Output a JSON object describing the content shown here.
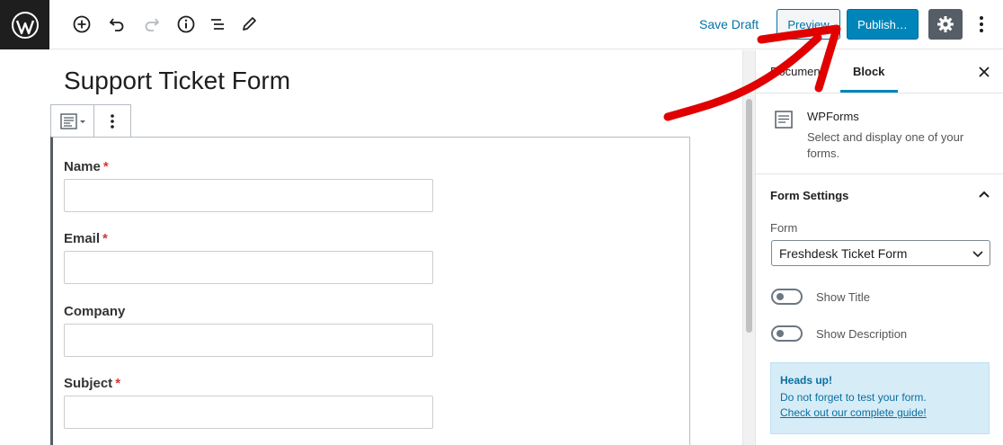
{
  "toolbar": {
    "save_draft_label": "Save Draft",
    "preview_label": "Preview",
    "publish_label": "Publish…",
    "colors": {
      "publish": "#0085ba",
      "settings": "#555d66",
      "link": "#0073aa"
    }
  },
  "editor": {
    "post_title": "Support Ticket Form",
    "fields": [
      {
        "label": "Name",
        "required": "*"
      },
      {
        "label": "Email",
        "required": "*"
      },
      {
        "label": "Company",
        "required": ""
      },
      {
        "label": "Subject",
        "required": "*"
      }
    ]
  },
  "sidebar": {
    "tabs": {
      "document": "Document",
      "block": "Block"
    },
    "block_card": {
      "title": "WPForms",
      "description": "Select and display one of your forms."
    },
    "panel": {
      "title": "Form Settings",
      "form_label": "Form",
      "form_selected": "Freshdesk Ticket Form",
      "toggles": [
        {
          "label": "Show Title",
          "state": "off"
        },
        {
          "label": "Show Description",
          "state": "off"
        }
      ]
    },
    "notice": {
      "title": "Heads up!",
      "text": "Do not forget to test your form.",
      "link": "Check out our complete guide!"
    }
  },
  "icons": {
    "logo": "wordpress-logo",
    "add": "add-block-icon",
    "undo": "undo-icon",
    "redo": "redo-icon",
    "info": "info-icon",
    "outline": "list-icon",
    "tools": "pencil-icon",
    "settings": "gear-icon",
    "more": "more-vertical-icon"
  }
}
